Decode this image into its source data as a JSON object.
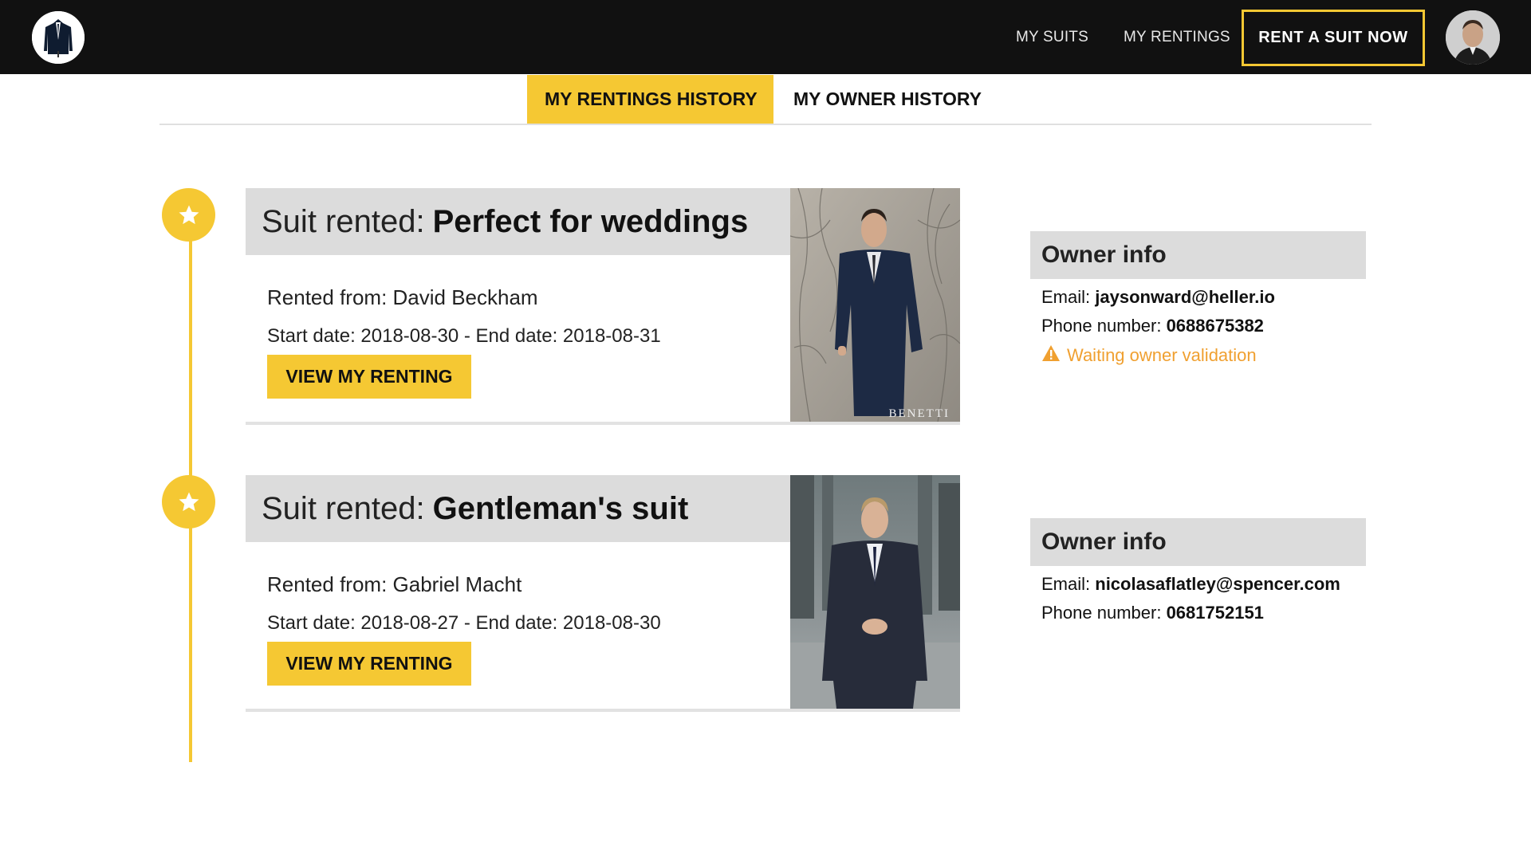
{
  "nav": {
    "links": [
      "MY SUITS",
      "MY RENTINGS"
    ],
    "cta_label": "RENT A SUIT NOW"
  },
  "tabs": [
    {
      "label": "MY RENTINGS HISTORY",
      "active": true
    },
    {
      "label": "MY OWNER HISTORY",
      "active": false
    }
  ],
  "rentals": [
    {
      "title_prefix": "Suit rented:",
      "suit_name": "Perfect for weddings",
      "rented_from": "Rented from: David Beckham",
      "dates": "Start date: 2018-08-30 - End date: 2018-08-31",
      "button_label": "VIEW MY RENTING",
      "photo_watermark": "BENETTI",
      "owner": {
        "heading": "Owner info",
        "email_label": "Email:",
        "email": "jaysonward@heller.io",
        "phone_label": "Phone number:",
        "phone": "0688675382",
        "status": "Waiting owner validation"
      }
    },
    {
      "title_prefix": "Suit rented:",
      "suit_name": "Gentleman's suit",
      "rented_from": "Rented from: Gabriel Macht",
      "dates": "Start date: 2018-08-27 - End date: 2018-08-30",
      "button_label": "VIEW MY RENTING",
      "owner": {
        "heading": "Owner info",
        "email_label": "Email:",
        "email": "nicolasaflatley@spencer.com",
        "phone_label": "Phone number:",
        "phone": "0681752151"
      }
    }
  ],
  "colors": {
    "accent": "#f5c833",
    "navbar": "#111111",
    "header_gray": "#dcdcdc",
    "warning": "#f0a030"
  },
  "icons": {
    "logo": "suit-logo-icon",
    "timeline": "star-icon",
    "status": "warning-triangle-icon"
  }
}
